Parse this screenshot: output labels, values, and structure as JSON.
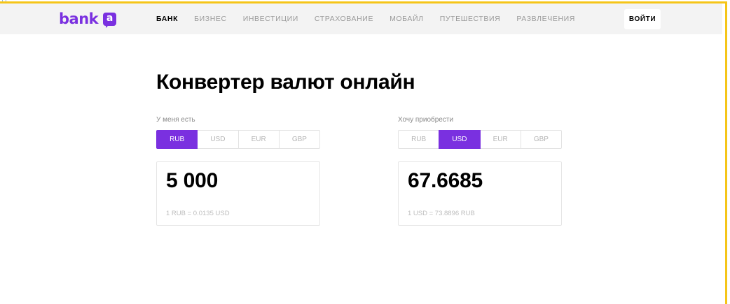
{
  "header": {
    "logo_text": "bank",
    "logo_badge": "a",
    "nav": [
      "БАНК",
      "БИЗНЕС",
      "ИНВЕСТИЦИИ",
      "СТРАХОВАНИЕ",
      "МОБАЙЛ",
      "ПУТЕШЕСТВИЯ",
      "РАЗВЛЕЧЕНИЯ"
    ],
    "active_nav": "БАНК",
    "login_label": "ВОЙТИ"
  },
  "page_title": "Конвертер валют онлайн",
  "converter": {
    "have": {
      "label": "У меня есть",
      "currencies": [
        "RUB",
        "USD",
        "EUR",
        "GBP"
      ],
      "selected": "RUB",
      "amount": "5 000",
      "rate": "1 RUB = 0.0135 USD"
    },
    "want": {
      "label": "Хочу приобрести",
      "currencies": [
        "RUB",
        "USD",
        "EUR",
        "GBP"
      ],
      "selected": "USD",
      "amount": "67.6685",
      "rate": "1 USD = 73.8896 RUB"
    }
  },
  "colors": {
    "brand": "#7a30e0",
    "header_bg": "#f3f3f3",
    "frame": "#f5c518"
  }
}
